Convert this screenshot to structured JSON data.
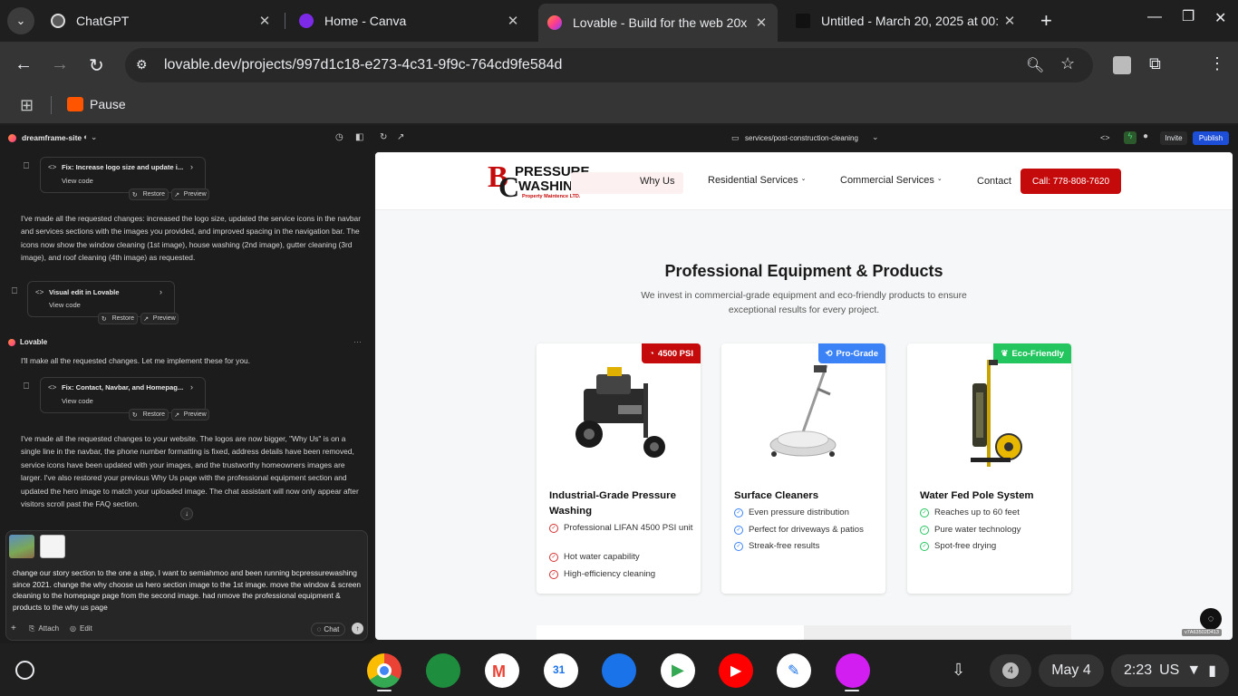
{
  "browser": {
    "tabs": [
      {
        "title": "ChatGPT",
        "icon": "chatgpt-icon",
        "color": "#5a5a5a"
      },
      {
        "title": "Home - Canva",
        "icon": "canva-icon",
        "color": "#7d2ae8"
      },
      {
        "title": "Lovable - Build for the web 20x",
        "icon": "lovable-icon",
        "color": "#ff5a7a"
      },
      {
        "title": "Untitled - March 20, 2025 at 00:",
        "icon": "untitled-icon",
        "color": "#222"
      }
    ],
    "url": "lovable.dev/projects/997d1c18-e273-4c31-9f9c-764cd9fe584d",
    "bookmark": "Pause"
  },
  "app": {
    "project": "dreamframe-site",
    "route": "services/post-construction-cleaning",
    "invite": "Invite",
    "publish": "Publish"
  },
  "chat": {
    "cards": [
      {
        "title": "Fix: Increase logo size and update i...",
        "view": "View code",
        "restore": "Restore",
        "preview": "Preview"
      },
      {
        "title": "Visual edit in Lovable",
        "view": "View code",
        "restore": "Restore",
        "preview": "Preview"
      },
      {
        "title": "Fix: Contact, Navbar, and Homepag...",
        "view": "View code",
        "restore": "Restore",
        "preview": "Preview"
      }
    ],
    "msg1": "I've made all the requested changes: increased the logo size, updated the service icons in the navbar and services sections with the images you provided, and improved spacing in the navigation bar. The icons now show the window cleaning (1st image), house washing (2nd image), gutter cleaning (3rd image), and roof cleaning (4th image) as requested.",
    "author": "Lovable",
    "msg2": "I'll make all the requested changes. Let me implement these for you.",
    "msg3": "I've made all the requested changes to your website. The logos are now bigger, \"Why Us\" is on a single line in the navbar, the phone number formatting is fixed, address details have been removed, service icons have been updated with your images, and the trustworthy homeowners images are larger. I've also restored your previous Why Us page with the professional equipment section and updated the hero image to match your uploaded image. The chat assistant will now only appear after visitors scroll past the FAQ section.",
    "input": "change our story section to the one a step, I want to semiahmoo and been running bcpressurewashing since 2021. change the why choose us hero section image to the 1st image. move the window & screen cleaning to the homepage page from the second image. had nmove the professional equipment & products to the why us page",
    "attach": "Attach",
    "edit": "Edit",
    "chat": "Chat"
  },
  "site": {
    "logo_line1": "PRESSURE",
    "logo_line2": "WASHING",
    "logo_tag": "Property Maintence LTD.",
    "nav": [
      "Why Us",
      "Residential Services",
      "Commercial Services",
      "Contact"
    ],
    "call": "Call: 778-808-7620",
    "heading": "Professional Equipment & Products",
    "subheading": "We invest in commercial-grade equipment and eco-friendly products to ensure exceptional results for every project.",
    "products": [
      {
        "badge": "4500 PSI",
        "badge_color": "#c40a0a",
        "check_color": "#d32f2f",
        "title": "Industrial-Grade Pressure Washing",
        "features": [
          "Professional LIFAN 4500 PSI unit",
          "Hot water capability",
          "High-efficiency cleaning"
        ]
      },
      {
        "badge": "Pro-Grade",
        "badge_color": "#3b82f6",
        "check_color": "#3b82f6",
        "title": "Surface Cleaners",
        "features": [
          "Even pressure distribution",
          "Perfect for driveways & patios",
          "Streak-free results"
        ]
      },
      {
        "badge": "Eco-Friendly",
        "badge_color": "#22c55e",
        "check_color": "#22c55e",
        "title": "Water Fed Pole System",
        "features": [
          "Reaches up to 60 feet",
          "Pure water technology",
          "Spot-free drying"
        ]
      }
    ],
    "version": "v7A63502D413"
  },
  "shelf": {
    "notifications": "4",
    "date": "May 4",
    "time": "2:23",
    "locale": "US"
  }
}
